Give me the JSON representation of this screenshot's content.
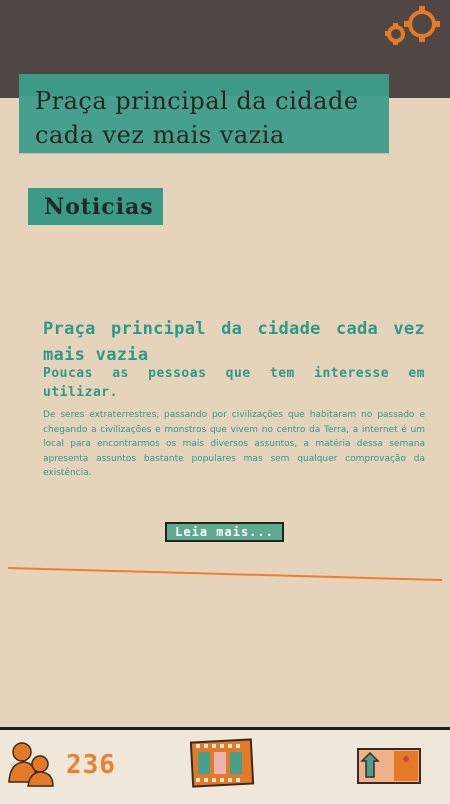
{
  "header": {
    "headline": "Praça principal da cidade cada vez mais vazia",
    "settings_icon": "gears-icon"
  },
  "section": {
    "label": "Noticias"
  },
  "article": {
    "title": "Praça principal da cidade cada vez mais vazia",
    "subtitle": "Poucas as pessoas que tem interesse em utilizar.",
    "body": "De seres extraterrestres, passando por civilizações que habitaram no passado e chegando a civilizações e monstros que vivem no centro da Terra, a internet é um local para encontrarmos os mais diversos assuntos, a matéria dessa semana apresenta assuntos bastante populares mas sem qualquer comprovação da existência.",
    "read_more": "Leia mais..."
  },
  "footer": {
    "count": "236",
    "icons": [
      "people-icon",
      "film-icon",
      "box-icon"
    ]
  },
  "colors": {
    "topbar": "#504744",
    "background": "#e6d3bb",
    "teal": "#3c9a86",
    "accent": "#ef7f2a"
  }
}
